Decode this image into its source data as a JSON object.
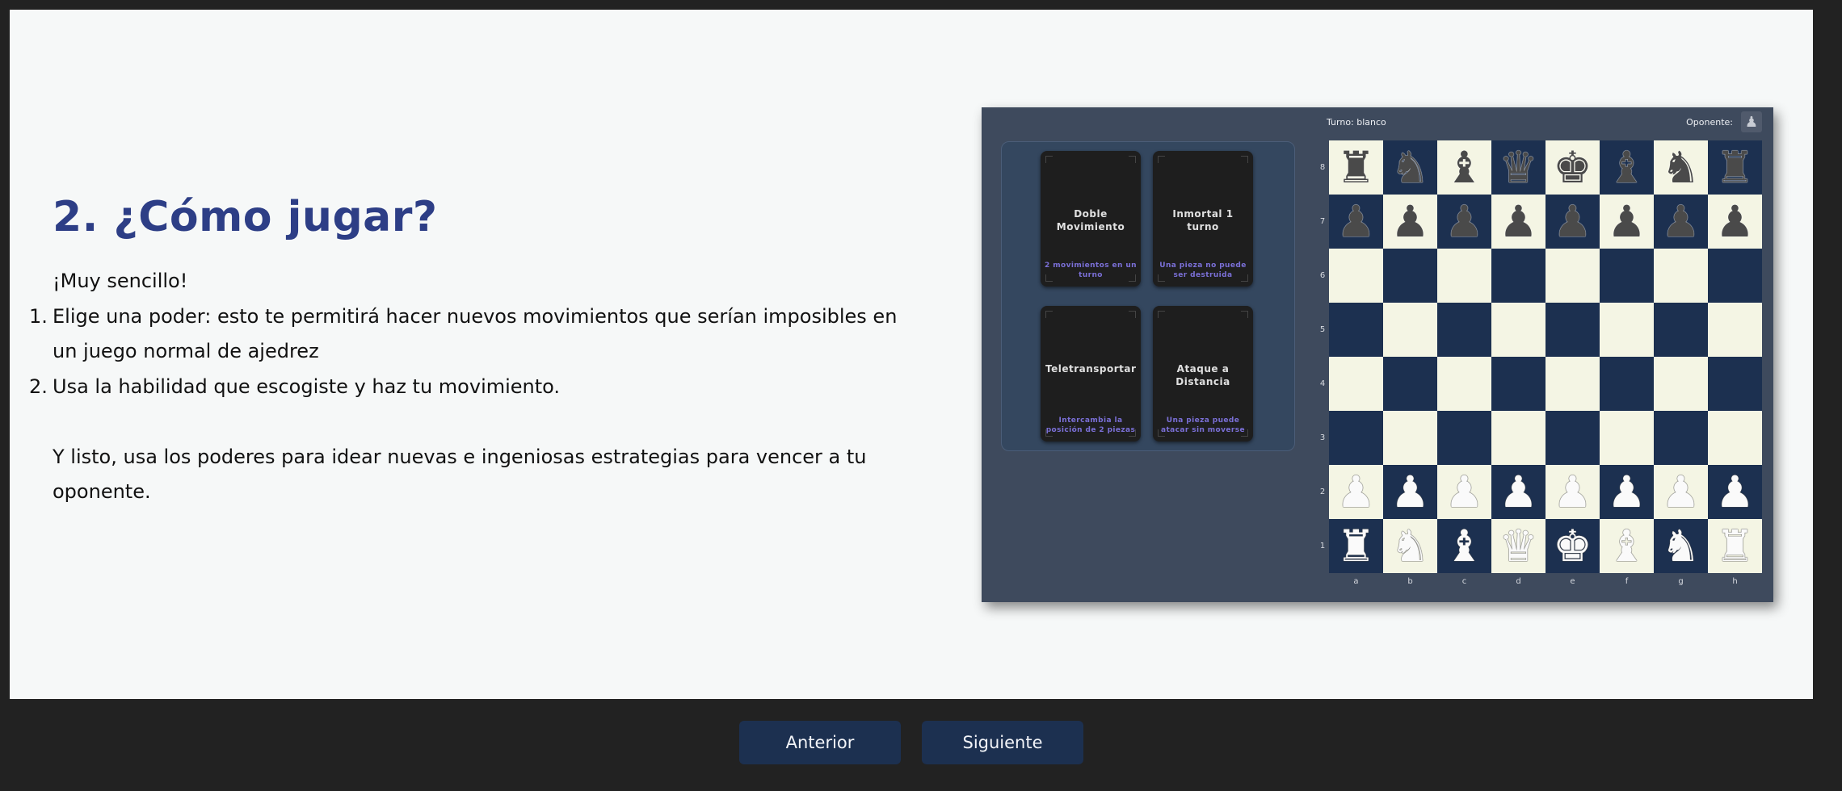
{
  "slide": {
    "title": "2. ¿Cómo jugar?",
    "intro": "¡Muy sencillo!",
    "steps": [
      {
        "num": "1.",
        "text": "Elige una poder: esto te permitirá hacer nuevos movimientos que serían imposibles en un juego normal de ajedrez"
      },
      {
        "num": "2.",
        "text": "Usa la habilidad que escogiste y haz tu movimiento."
      }
    ],
    "outro": "Y listo, usa los poderes para idear nuevas e ingeniosas estrategias para vencer a tu oponente."
  },
  "game": {
    "turn_label": "Turno: blanco",
    "opponent_label": "Oponente:",
    "opponent_avatar_icon": "pawn-avatar-icon",
    "cards": [
      {
        "name": "Doble Movimiento",
        "desc": "2 movimientos en un turno"
      },
      {
        "name": "Inmortal 1 turno",
        "desc": "Una pieza no puede ser destruida"
      },
      {
        "name": "Teletransportar",
        "desc": "Intercambia la posición de 2 piezas"
      },
      {
        "name": "Ataque a Distancia",
        "desc": "Una pieza puede atacar sin moverse"
      }
    ],
    "ranks": [
      "8",
      "7",
      "6",
      "5",
      "4",
      "3",
      "2",
      "1"
    ],
    "files": [
      "a",
      "b",
      "c",
      "d",
      "e",
      "f",
      "g",
      "h"
    ],
    "board": [
      [
        "r",
        "n",
        "b",
        "q",
        "k",
        "b",
        "n",
        "r"
      ],
      [
        "p",
        "p",
        "p",
        "p",
        "p",
        "p",
        "p",
        "p"
      ],
      [
        "",
        "",
        "",
        "",
        "",
        "",
        "",
        ""
      ],
      [
        "",
        "",
        "",
        "",
        "",
        "",
        "",
        ""
      ],
      [
        "",
        "",
        "",
        "",
        "",
        "",
        "",
        ""
      ],
      [
        "",
        "",
        "",
        "",
        "",
        "",
        "",
        ""
      ],
      [
        "P",
        "P",
        "P",
        "P",
        "P",
        "P",
        "P",
        "P"
      ],
      [
        "R",
        "N",
        "B",
        "Q",
        "K",
        "B",
        "N",
        "R"
      ]
    ],
    "colors": {
      "dark_square": "#1c3050",
      "light_square": "#f4f5e4",
      "card_desc": "#7a6fd6",
      "title": "#2d3e86"
    }
  },
  "nav": {
    "prev_label": "Anterior",
    "next_label": "Siguiente"
  }
}
